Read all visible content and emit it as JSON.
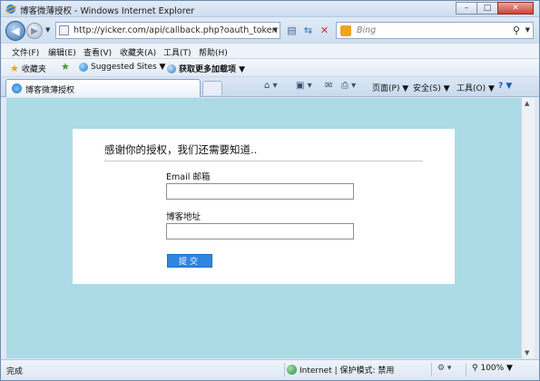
{
  "window": {
    "title": "博客微薄授权 - Windows Internet Explorer",
    "minimize_glyph": "–",
    "maximize_glyph": "□",
    "close_glyph": "✕"
  },
  "address_bar": {
    "url": "http://yicker.com/api/callback.php?oauth_token=dd",
    "search_placeholder": "Bing"
  },
  "menu": {
    "items": [
      "文件(F)",
      "编辑(E)",
      "查看(V)",
      "收藏夹(A)",
      "工具(T)",
      "帮助(H)"
    ]
  },
  "favorites_bar": {
    "favorites_label": "收藏夹",
    "suggested_sites_label": "Suggested Sites ▼",
    "get_addons_label": "获取更多加载项 ▼"
  },
  "tabs": {
    "active_label": "博客微薄授权"
  },
  "command_bar": {
    "page_label": "页面(P) ▼",
    "safety_label": "安全(S) ▼",
    "tools_label": "工具(O) ▼",
    "help_glyph": "? ▼"
  },
  "form": {
    "heading": "感谢你的授权，我们还需要知道..",
    "email_label": "Email 邮箱",
    "email_value": "",
    "blog_label": "博客地址",
    "blog_value": "",
    "submit_label": "提交"
  },
  "status_bar": {
    "status": "完成",
    "zone": "Internet | 保护模式: 禁用",
    "zoom": "100%  ▼"
  },
  "colors": {
    "page_background": "#acdbe6",
    "submit_button": "#2f86df"
  }
}
